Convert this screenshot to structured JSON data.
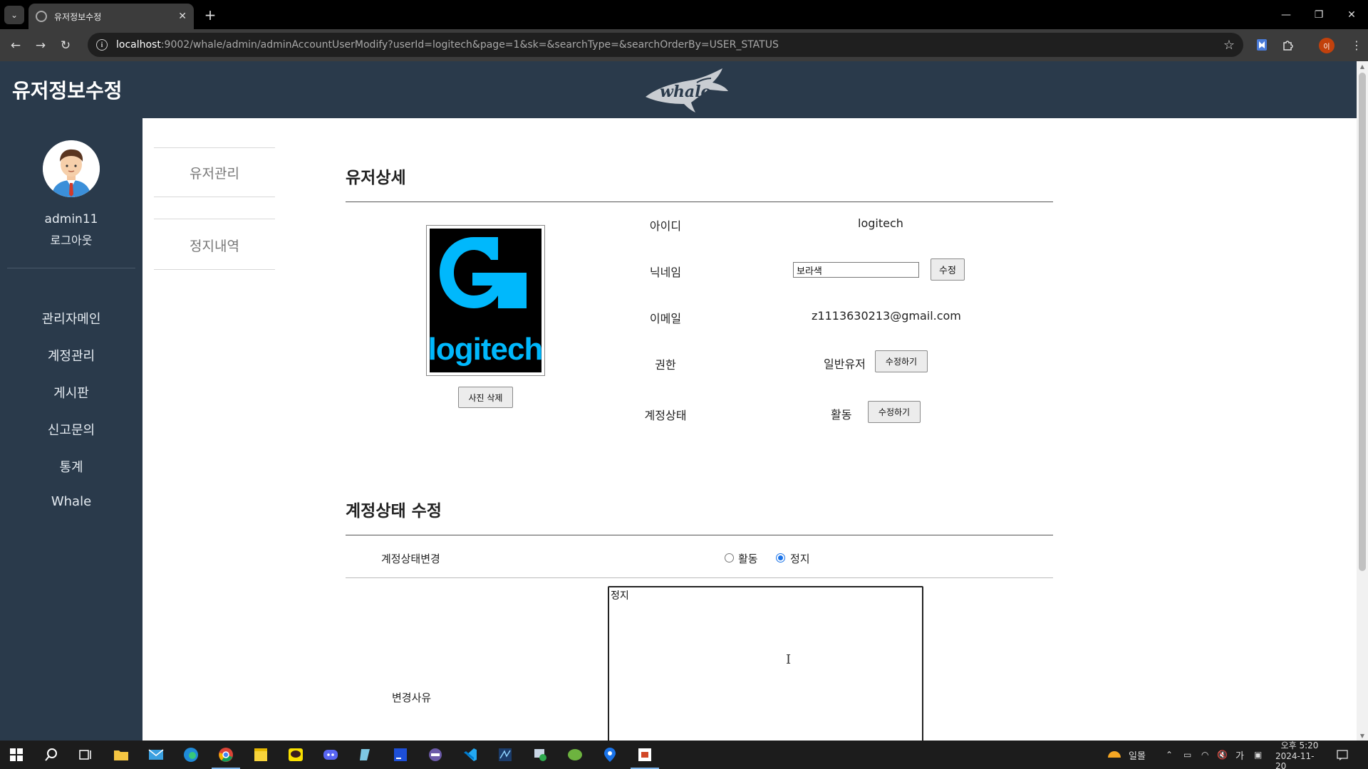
{
  "browser": {
    "tab_title": "유저정보수정",
    "url_host": "localhost",
    "url_rest": ":9002/whale/admin/adminAccountUserModify?userId=logitech&page=1&sk=&searchType=&searchOrderBy=USER_STATUS",
    "profile_initial": "이"
  },
  "header": {
    "page_title": "유저정보수정",
    "logo_alt": "whale"
  },
  "sidebar": {
    "admin_name": "admin11",
    "logout": "로그아웃",
    "menu": [
      "관리자메인",
      "계정관리",
      "게시판",
      "신고문의",
      "통계",
      "Whale"
    ]
  },
  "subnav": [
    "유저관리",
    "정지내역"
  ],
  "user_detail": {
    "title": "유저상세",
    "photo_logo_text": "logitech",
    "delete_photo_button": "사진 삭제",
    "fields": {
      "id_label": "아이디",
      "id_value": "logitech",
      "nickname_label": "닉네임",
      "nickname_value": "보라색",
      "nickname_button": "수정",
      "email_label": "이메일",
      "email_value": "z1113630213@gmail.com",
      "role_label": "권한",
      "role_value": "일반유저",
      "role_button": "수정하기",
      "status_label": "계정상태",
      "status_value": "활동",
      "status_button": "수정하기"
    }
  },
  "status_edit": {
    "title": "계정상태 수정",
    "change_label": "계정상태변경",
    "options": [
      {
        "label": "활동",
        "checked": false
      },
      {
        "label": "정지",
        "checked": true
      }
    ],
    "reason_label": "변경사유",
    "reason_value": "정지"
  },
  "taskbar": {
    "weather_text": "일몰",
    "ime": "가",
    "time": "오후 5:20",
    "date": "2024-11-20"
  },
  "colors": {
    "header_bg": "#2a3a4b",
    "sidebar_bg": "#2a3a4b",
    "logitech_blue": "#00b8fc"
  }
}
